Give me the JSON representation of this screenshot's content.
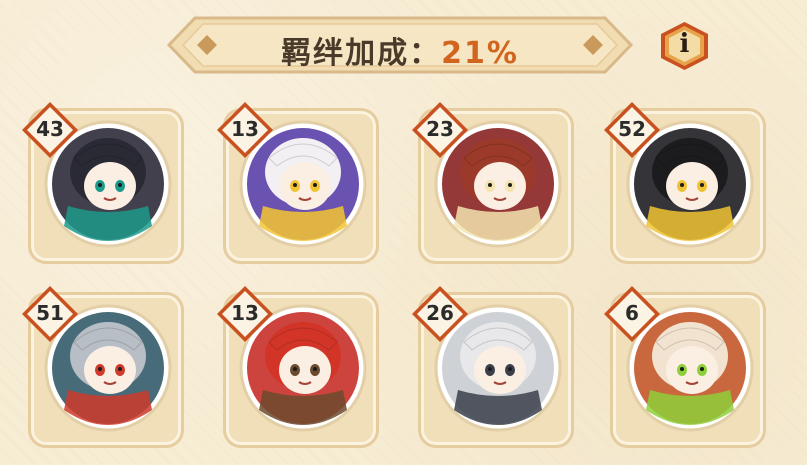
{
  "header": {
    "label": "羁绊加成：",
    "value": "21%"
  },
  "info_button": {
    "letter": "i",
    "icon": "info-icon"
  },
  "colors": {
    "background": "#f7ecd4",
    "banner_fill": "#f2ddb2",
    "accent_orange": "#d2651e",
    "badge_border": "#c9511f",
    "info_button_fill": "#e8a24a"
  },
  "shikigami": [
    {
      "count": "43",
      "theme": "dark-hooded-shikigami",
      "main": "#2f2b3a",
      "accent": "#1c9a8a",
      "hair": "#2a2a35"
    },
    {
      "count": "13",
      "theme": "white-haired-horned-shikigami",
      "main": "#5a3fa8",
      "accent": "#f3c431",
      "hair": "#f3f0f4"
    },
    {
      "count": "23",
      "theme": "red-haired-oni-shikigami",
      "main": "#8a2222",
      "accent": "#f3e4b0",
      "hair": "#9b3a2a"
    },
    {
      "count": "52",
      "theme": "black-haired-horned-shikigami",
      "main": "#1f1f24",
      "accent": "#f0c232",
      "hair": "#1c1c1f"
    },
    {
      "count": "51",
      "theme": "silver-haired-mask-shikigami",
      "main": "#345b6a",
      "accent": "#cf3a2a",
      "hair": "#b7bec5"
    },
    {
      "count": "13",
      "theme": "red-flame-haired-shikigami",
      "main": "#c8302a",
      "accent": "#6b4a2e",
      "hair": "#d23528"
    },
    {
      "count": "26",
      "theme": "white-long-haired-shikigami",
      "main": "#c9ccd2",
      "accent": "#3a3f4a",
      "hair": "#e8e8ea"
    },
    {
      "count": "6",
      "theme": "orange-hat-shikigami",
      "main": "#c3582a",
      "accent": "#8fcf3a",
      "hair": "#f1e3cf"
    }
  ]
}
